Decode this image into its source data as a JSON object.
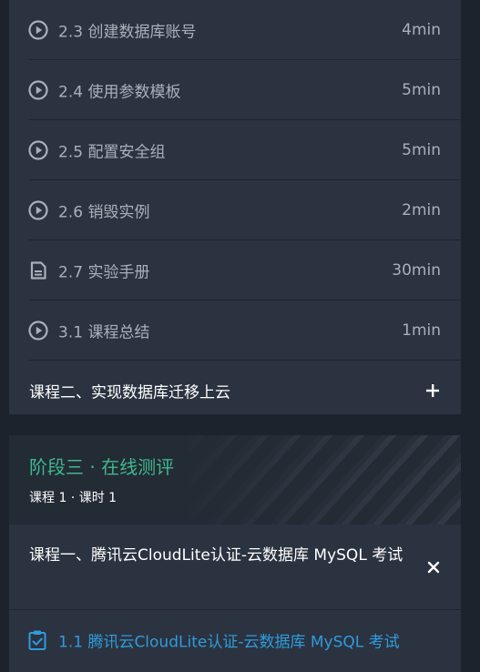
{
  "lessons": [
    {
      "title": "2.3 创建数据库账号",
      "duration": "4min",
      "icon": "play-circle-icon"
    },
    {
      "title": "2.4 使用参数模板",
      "duration": "5min",
      "icon": "play-circle-icon"
    },
    {
      "title": "2.5 配置安全组",
      "duration": "5min",
      "icon": "play-circle-icon"
    },
    {
      "title": "2.6 销毁实例",
      "duration": "2min",
      "icon": "play-circle-icon"
    },
    {
      "title": "2.7 实验手册",
      "duration": "30min",
      "icon": "document-icon"
    },
    {
      "title": "3.1 课程总结",
      "duration": "1min",
      "icon": "play-circle-icon"
    }
  ],
  "course2": {
    "title": "课程二、实现数据库迁移上云",
    "toggle_icon": "plus-icon"
  },
  "stage3": {
    "title": "阶段三 · 在线测评",
    "meta": "课程 1 · 课时 1"
  },
  "course1": {
    "title": "课程一、腾讯云CloudLite认证-云数据库 MySQL 考试",
    "toggle_icon": "close-icon"
  },
  "exam_lesson": {
    "title": "1.1 腾讯云CloudLite认证-云数据库 MySQL 考试",
    "icon": "exam-clipboard-icon"
  },
  "colors": {
    "accent_green": "#3fb98f",
    "accent_blue": "#2f9bdc",
    "card_bg": "#2b3340",
    "page_bg": "#1d232c"
  }
}
